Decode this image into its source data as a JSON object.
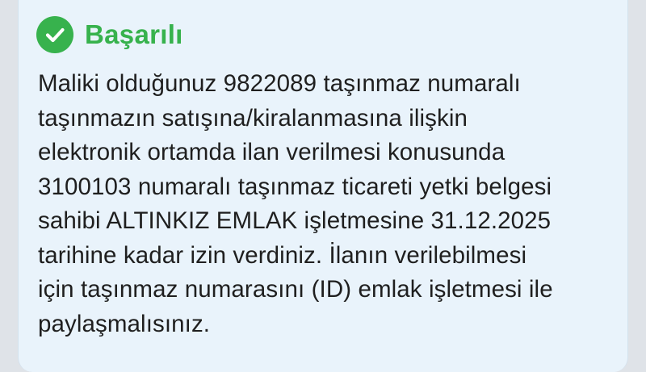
{
  "dialog": {
    "title": "Başarılı",
    "icon": "check-circle-icon",
    "accent_color": "#37b24d",
    "message_lines": [
      "Maliki olduğunuz 9822089 taşınmaz numaralı",
      "taşınmazın satışına/kiralanmasına ilişkin",
      "elektronik ortamda ilan verilmesi konusunda",
      "3100103 numaralı taşınmaz ticareti yetki belgesi",
      "sahibi ALTINKIZ EMLAK işletmesine 31.12.2025",
      "tarihine kadar izin verdiniz. İlanın verilebilmesi",
      "için taşınmaz numarasını (ID) emlak işletmesi ile",
      "paylaşmalısınız."
    ]
  }
}
